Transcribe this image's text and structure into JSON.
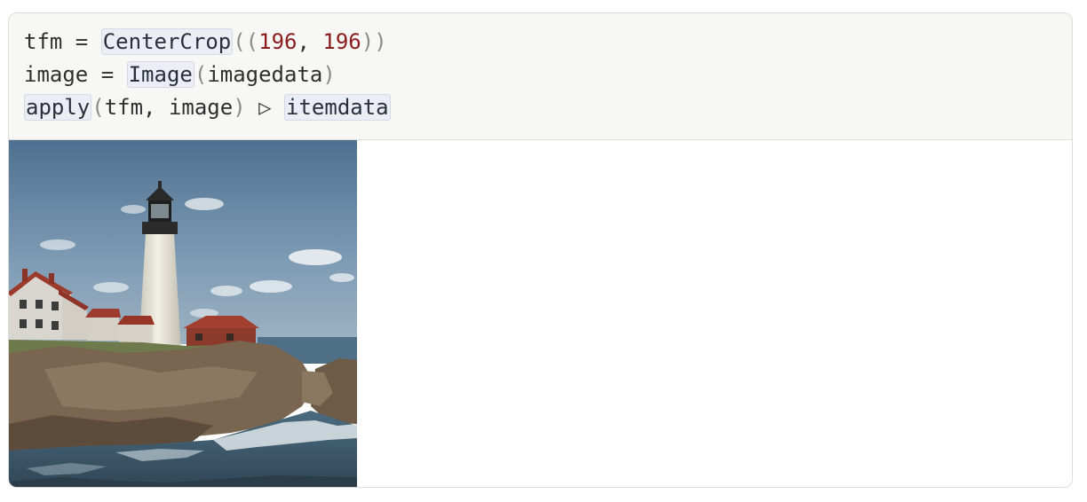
{
  "cell": {
    "code_lines": [
      {
        "var": "tfm",
        "eq": " = ",
        "fn": "CenterCrop",
        "open": "((",
        "arg1": "196",
        "comma": ", ",
        "arg2": "196",
        "close": "))"
      },
      {
        "var": "image",
        "eq": " = ",
        "fn": "Image",
        "open": "(",
        "arg": "imagedata",
        "close": ")"
      },
      {
        "fn": "apply",
        "open": "(",
        "args": "tfm, image",
        "close": ")",
        "pipe": " ▷ ",
        "fn2": "itemdata"
      }
    ]
  },
  "output": {
    "image_alt": "lighthouse-photo",
    "colors": {
      "sky": "#5f7f9d",
      "tower": "#e9e6dc",
      "roof": "#9c3b2e",
      "rocks": "#6d5a46",
      "water": "#3c5869"
    }
  }
}
